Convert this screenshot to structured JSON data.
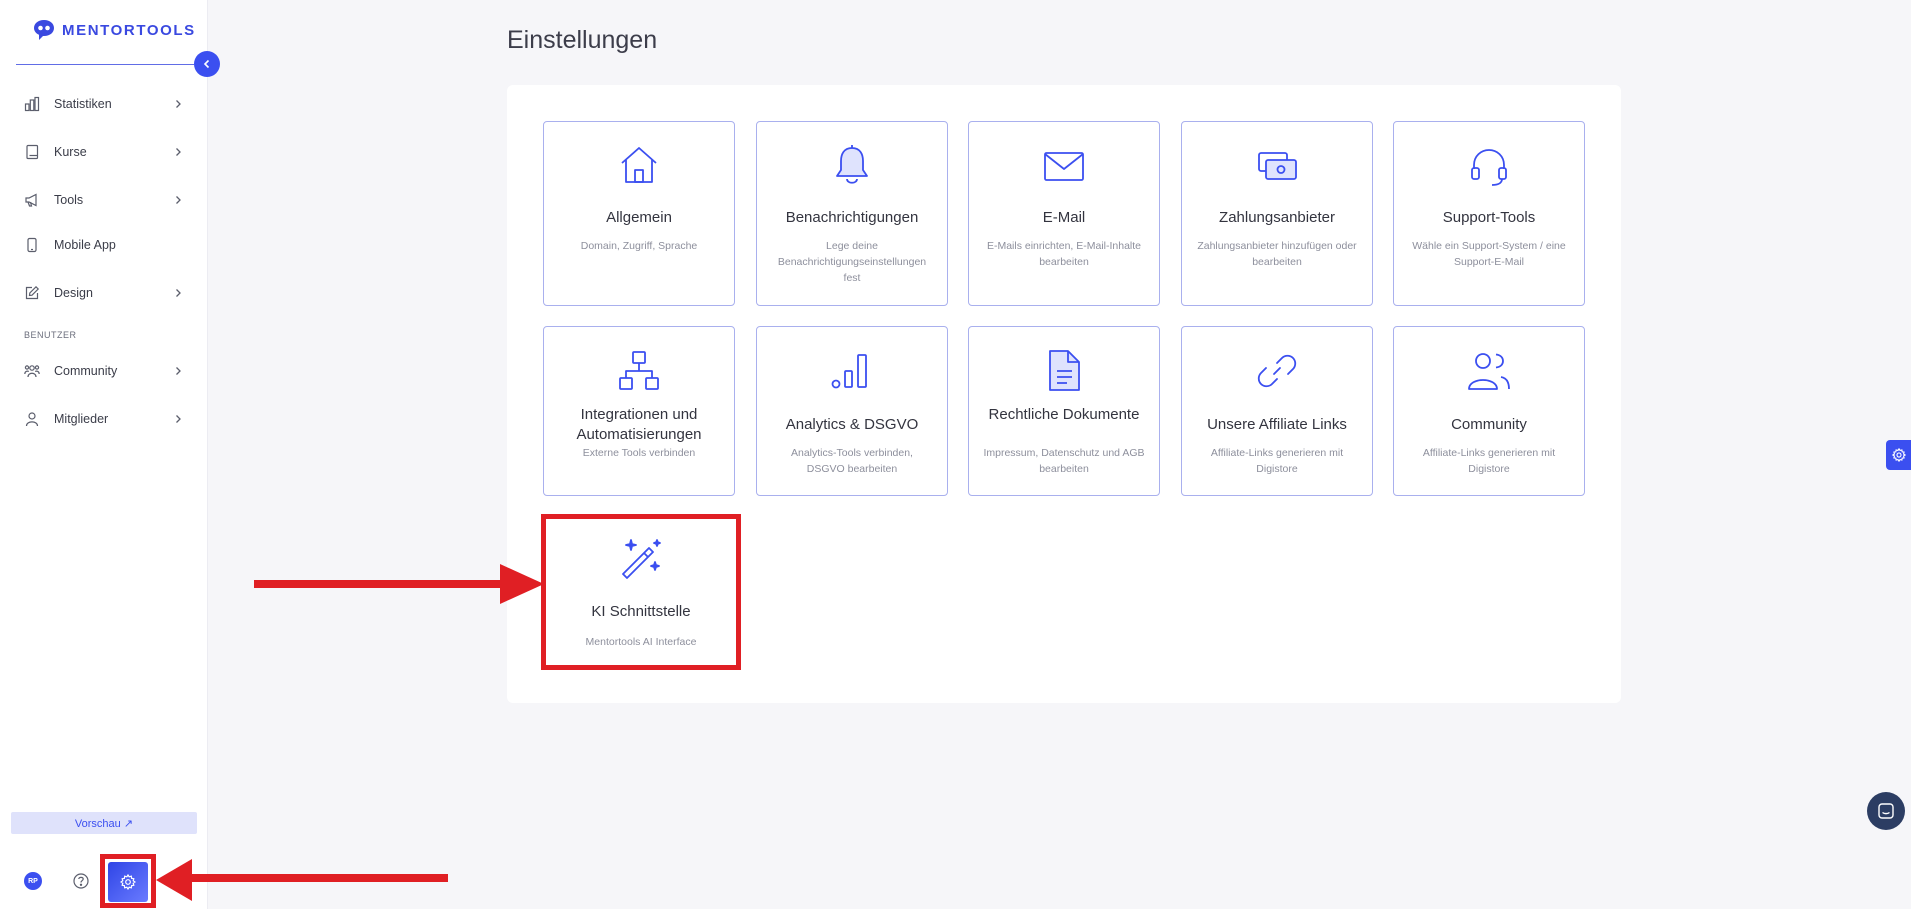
{
  "brand": {
    "name": "MENTORTOOLS",
    "color": "#3a49e0"
  },
  "sidebar": {
    "items": [
      {
        "label": "Statistiken",
        "icon": "bar-chart-icon",
        "has_chevron": true
      },
      {
        "label": "Kurse",
        "icon": "book-icon",
        "has_chevron": true
      },
      {
        "label": "Tools",
        "icon": "megaphone-icon",
        "has_chevron": true
      },
      {
        "label": "Mobile App",
        "icon": "smartphone-icon",
        "has_chevron": false
      },
      {
        "label": "Design",
        "icon": "pencil-square-icon",
        "has_chevron": true
      }
    ],
    "section_label": "BENUTZER",
    "user_items": [
      {
        "label": "Community",
        "icon": "users-icon",
        "has_chevron": true
      },
      {
        "label": "Mitglieder",
        "icon": "user-icon",
        "has_chevron": true
      }
    ],
    "preview_label": "Vorschau ↗",
    "avatar_initials": "RP"
  },
  "main": {
    "title": "Einstellungen",
    "cards": [
      {
        "title": "Allgemein",
        "description": "Domain, Zugriff, Sprache",
        "icon": "home-icon"
      },
      {
        "title": "Benachrichtigungen",
        "description": "Lege deine Benachrichtigungseinstellungen fest",
        "icon": "bell-icon"
      },
      {
        "title": "E-Mail",
        "description": "E-Mails einrichten, E-Mail-Inhalte bearbeiten",
        "icon": "envelope-icon"
      },
      {
        "title": "Zahlungsanbieter",
        "description": "Zahlungsanbieter hinzufügen oder bearbeiten",
        "icon": "cash-icon"
      },
      {
        "title": "Support-Tools",
        "description": "Wähle ein Support-System / eine Support-E-Mail",
        "icon": "headset-icon"
      },
      {
        "title": "Integrationen und Automatisierungen",
        "description": "Externe Tools verbinden",
        "icon": "hierarchy-icon"
      },
      {
        "title": "Analytics & DSGVO",
        "description": "Analytics-Tools verbinden, DSGVO bearbeiten",
        "icon": "analytics-icon"
      },
      {
        "title": "Rechtliche Dokumente",
        "description": "Impressum, Datenschutz und AGB bearbeiten",
        "icon": "document-icon"
      },
      {
        "title": "Unsere Affiliate Links",
        "description": "Affiliate-Links generieren mit Digistore",
        "icon": "link-icon"
      },
      {
        "title": "Community",
        "description": "Affiliate-Links generieren mit Digistore",
        "icon": "users-icon"
      },
      {
        "title": "KI Schnittstelle",
        "description": "Mentortools AI Interface",
        "icon": "magic-wand-icon"
      }
    ]
  },
  "colors": {
    "accent": "#3b4ff0",
    "highlight": "#e01f24",
    "card_border": "#a9b0ee",
    "chat_button": "#2c3d63"
  }
}
